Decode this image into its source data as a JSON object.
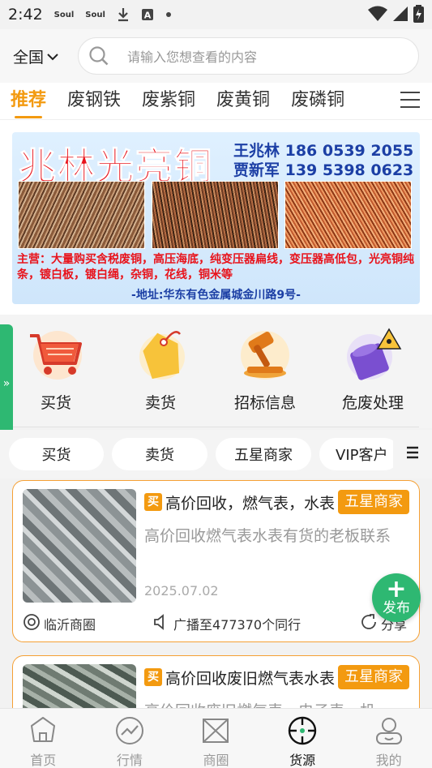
{
  "status_bar": {
    "time": "2:42",
    "notif1": "Soul",
    "notif2": "Soul"
  },
  "search": {
    "region": "全国",
    "placeholder": "请输入您想查看的内容"
  },
  "tabs": [
    {
      "label": "推荐",
      "active": true
    },
    {
      "label": "废钢铁",
      "active": false
    },
    {
      "label": "废紫铜",
      "active": false
    },
    {
      "label": "废黄铜",
      "active": false
    },
    {
      "label": "废磷铜",
      "active": false
    }
  ],
  "banner": {
    "title": "兆林光亮铜",
    "contact1": "王兆林 186 0539 2055",
    "contact2": "贾新军 139 5398 0623",
    "desc": "主营：大量购买含税废铜，高压海底，纯变压器扁线，变压器高低包，光亮铜纯条，镀白板，镀白绳，杂铜，花线，铜米等",
    "address": "-地址:华东有色金属城金川路9号-"
  },
  "quick": [
    {
      "label": "买货",
      "icon": "shopping-basket-icon"
    },
    {
      "label": "卖货",
      "icon": "price-tag-icon"
    },
    {
      "label": "招标信息",
      "icon": "auction-hammer-icon"
    },
    {
      "label": "危废处理",
      "icon": "hazard-barrel-icon"
    }
  ],
  "side_tab": "»",
  "chips": [
    "买货",
    "卖货",
    "五星商家",
    "VIP客户"
  ],
  "cards": [
    {
      "tag": "买",
      "title": "高价回收，燃气表，水表",
      "badge": "五星商家",
      "desc": "高价回收燃气表水表有货的老板联系",
      "date": "2025.07.02",
      "circle": "临沂商圈",
      "broadcast": "广播至477370个同行",
      "share": "分享"
    },
    {
      "tag": "买",
      "title": "高价回收废旧燃气表水表",
      "badge": "五星商家",
      "desc": "高价回收废旧燃气表，电子表，机"
    }
  ],
  "fab": {
    "plus": "+",
    "label": "发布"
  },
  "nav": [
    {
      "label": "首页",
      "active": false
    },
    {
      "label": "行情",
      "active": false
    },
    {
      "label": "商圈",
      "active": false
    },
    {
      "label": "货源",
      "active": true
    },
    {
      "label": "我的",
      "active": false
    }
  ],
  "colors": {
    "accent": "#f39a10",
    "green": "#2eb872",
    "banner_red": "#e8131b",
    "banner_blue": "#1c3fa5"
  }
}
